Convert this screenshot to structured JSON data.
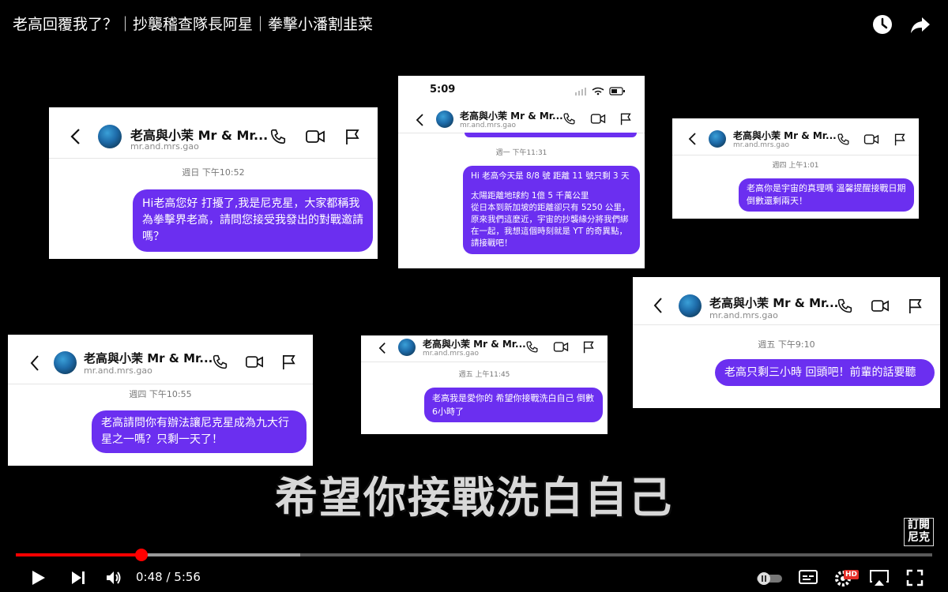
{
  "video": {
    "title": "老高回覆我了？｜抄襲稽查隊長阿星｜拳擊小潘割韭菜",
    "subtitle": "希望你接戰洗白自己",
    "subscribe_badge": "訂閱 尼克",
    "current_time": "0:48",
    "separator": " / ",
    "duration": "5:56",
    "progress": 0.137,
    "buffered": 0.31,
    "hd_badge": "HD"
  },
  "dm_cards": [
    {
      "name": "老高與小茉 Mr & Mr...",
      "handle": "mr.and.mrs.gao",
      "timestamp": "週日 下午10:52",
      "message": "Hi老高您好 打擾了,我是尼克星，大家都稱我為拳擊界老高，請問您接受我發出的對戰邀請嗎？"
    },
    {
      "status_time": "5:09",
      "name": "老高與小茉 Mr & Mr...",
      "handle": "mr.and.mrs.gao",
      "timestamp": "週一 下午11:31",
      "message_line1": "Hi 老高今天是 8/8 號 距離 11 號只剩 3 天",
      "message_line2": "太陽距離地球約 1億 5 千萬公里",
      "message_line3": "從日本到新加坡的距離卻只有 5250 公里，原來我們這麼近，宇宙的抄襲緣分將我們綁在一起，我想這個時刻就是 YT 的奇異點，請接戰吧！"
    },
    {
      "name": "老高與小茉 Mr & Mr...",
      "handle": "mr.and.mrs.gao",
      "timestamp": "週四 上午1:01",
      "message": "老高你是宇宙的真理嗎 溫馨提醒接戰日期倒數還剩兩天！"
    },
    {
      "name": "老高與小茉 Mr & Mr...",
      "handle": "mr.and.mrs.gao",
      "timestamp": "週五 下午9:10",
      "message": "老高只剩三小時 回頭吧！前輩的話要聽"
    },
    {
      "name": "老高與小茉 Mr & Mr...",
      "handle": "mr.and.mrs.gao",
      "timestamp": "週四 下午10:55",
      "message": "老高請問你有辦法讓尼克星成為九大行星之一嗎？只剩一天了！"
    },
    {
      "name": "老高與小茉 Mr & Mr...",
      "handle": "mr.and.mrs.gao",
      "timestamp": "週五 上午11:45",
      "message": "老高我是愛你的 希望你接戰洗白自己 倒數6小時了"
    }
  ],
  "icons": {
    "watch_later": "clock-icon",
    "share": "share-arrow-icon",
    "play": "play-icon",
    "next": "skip-next-icon",
    "volume": "volume-icon",
    "autoplay": "autoplay-toggle-icon",
    "captions": "captions-icon",
    "settings": "settings-gear-icon",
    "airplay": "airplay-icon",
    "fullscreen": "fullscreen-icon",
    "back": "chevron-left-icon",
    "phone": "phone-icon",
    "video": "video-camera-icon",
    "flag": "flag-icon"
  },
  "colors": {
    "bubble": "#6b2ff0",
    "progress": "#ff0000"
  }
}
